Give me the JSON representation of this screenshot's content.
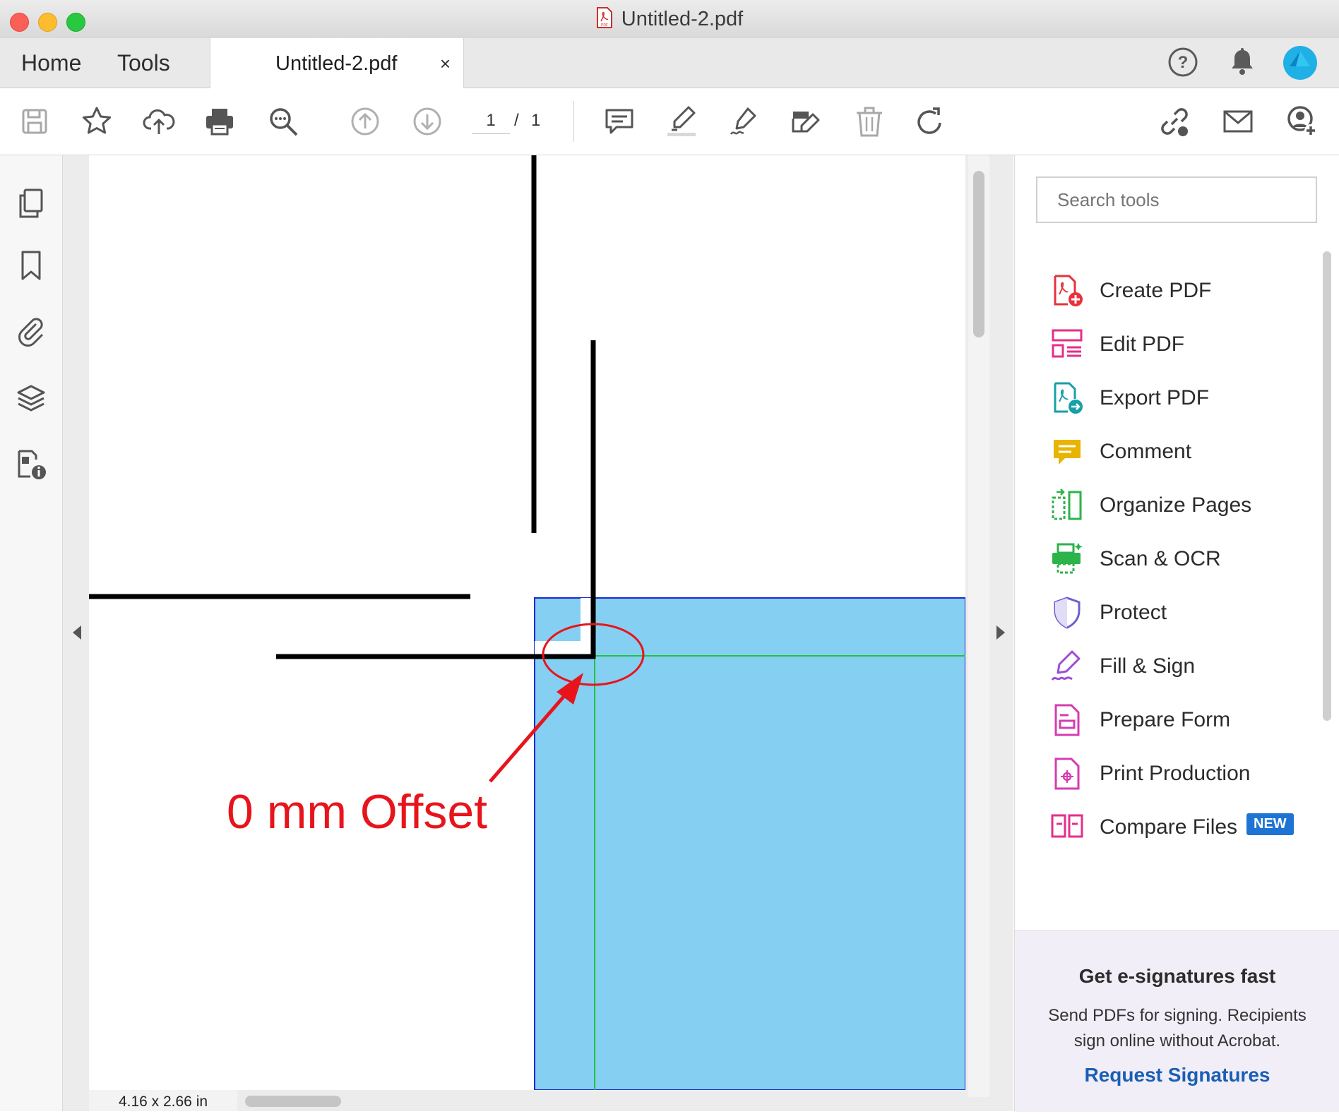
{
  "window": {
    "title": "Untitled-2.pdf"
  },
  "tabs": {
    "home": "Home",
    "tools": "Tools",
    "document": "Untitled-2.pdf",
    "close_symbol": "×"
  },
  "toolbar": {
    "page_current": "1",
    "page_separator": "/",
    "page_total": "1"
  },
  "left_nav": [
    "page-thumbnails-icon",
    "bookmarks-icon",
    "attachments-icon",
    "layers-icon",
    "document-properties-icon"
  ],
  "document": {
    "annotation_text": "0 mm Offset",
    "page_size": "4.16 x 2.66 in",
    "colors": {
      "bleed_fill": "#85cff2",
      "trim_line": "#22c43a",
      "bleed_border": "#1a2bd0",
      "annotation": "#e8141b",
      "crop_marks": "#000000"
    }
  },
  "right_panel": {
    "search_placeholder": "Search tools",
    "tools": [
      {
        "label": "Create PDF",
        "icon": "create-pdf-icon",
        "color": "#e8323c"
      },
      {
        "label": "Edit PDF",
        "icon": "edit-pdf-icon",
        "color": "#e62e8a"
      },
      {
        "label": "Export PDF",
        "icon": "export-pdf-icon",
        "color": "#16a0a8"
      },
      {
        "label": "Comment",
        "icon": "comment-icon",
        "color": "#e9b400"
      },
      {
        "label": "Organize Pages",
        "icon": "organize-pages-icon",
        "color": "#2cb34a"
      },
      {
        "label": "Scan & OCR",
        "icon": "scan-ocr-icon",
        "color": "#2cb34a"
      },
      {
        "label": "Protect",
        "icon": "protect-icon",
        "color": "#6a5fd1"
      },
      {
        "label": "Fill & Sign",
        "icon": "fill-sign-icon",
        "color": "#9b4ed6"
      },
      {
        "label": "Prepare Form",
        "icon": "prepare-form-icon",
        "color": "#d63cb0"
      },
      {
        "label": "Print Production",
        "icon": "print-production-icon",
        "color": "#d63cb0"
      },
      {
        "label": "Compare Files",
        "icon": "compare-files-icon",
        "color": "#e62e8a"
      }
    ],
    "new_badge": "NEW",
    "promo": {
      "title": "Get e-signatures fast",
      "body": "Send PDFs for signing. Recipients sign online without Acrobat.",
      "link": "Request Signatures"
    }
  }
}
